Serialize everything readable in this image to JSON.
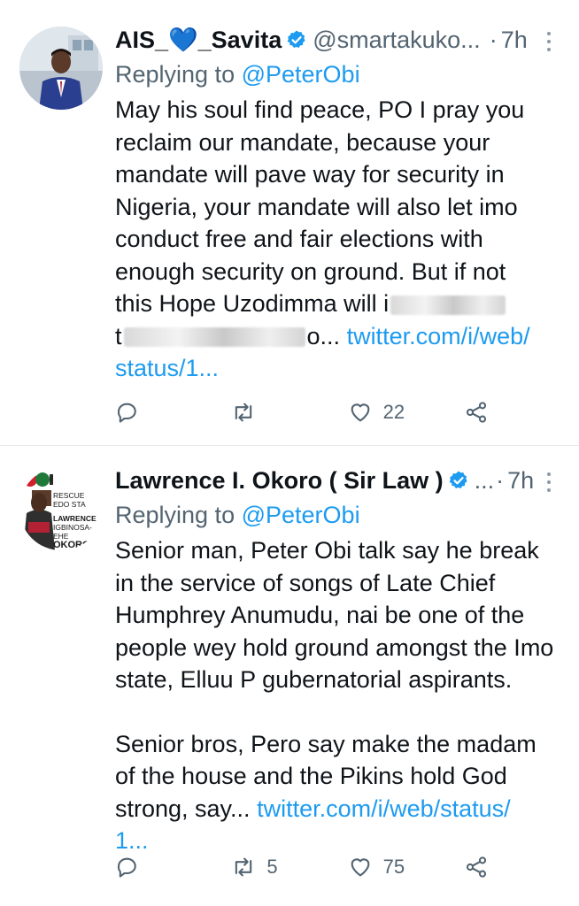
{
  "colors": {
    "link": "#1d9bf0",
    "secondary_text": "#536471",
    "primary_text": "#0f1419",
    "verified": "#1d9bf0"
  },
  "tweets": [
    {
      "display_name": "AIS_💙_Savita",
      "verified": true,
      "handle": "@smartakuko...",
      "separator": "·",
      "time": "7h",
      "replying_prefix": "Replying to",
      "replying_to": "@PeterObi",
      "body": [
        "May his soul find peace, PO I pray you",
        "reclaim our mandate, because your",
        "mandate will pave way for security in",
        "Nigeria, your mandate will also let imo",
        "conduct free and fair elections with",
        "enough security on ground. But if not",
        "this Hope Uzodimma will i"
      ],
      "body_after_blur": "t",
      "body_tail": "o...",
      "link": "twitter.com/i/web/",
      "link_continued": "status/1...",
      "replies": "",
      "retweets": "",
      "likes": "22"
    },
    {
      "display_name": "Lawrence I. Okoro ( Sir Law )",
      "verified": true,
      "handle": "...",
      "separator": "·",
      "time": "7h",
      "replying_prefix": "Replying to",
      "replying_to": "@PeterObi",
      "body": [
        "Senior man, Peter Obi talk say he break",
        "in the service of songs of Late Chief",
        "Humphrey Anumudu, nai be one of the",
        "people wey hold ground amongst the Imo",
        "state, Elluu P gubernatorial aspirants."
      ],
      "body2": [
        "Senior bros, Pero say make the madam",
        "of the house and the Pikins hold God"
      ],
      "body2_last": "strong, say...",
      "link": "twitter.com/i/web/status/",
      "link_continued": "1...",
      "replies": "",
      "retweets": "5",
      "likes": "75"
    }
  ],
  "avatar2_text": [
    "RESCUE EDO STA",
    "LAWRENCE",
    "IGBINOSA-EHE",
    "OKORO"
  ],
  "icons": {
    "reply": "reply-icon",
    "retweet": "retweet-icon",
    "like": "heart-icon",
    "share": "share-icon",
    "more": "more-vertical-icon",
    "verified": "verified-badge-icon"
  }
}
